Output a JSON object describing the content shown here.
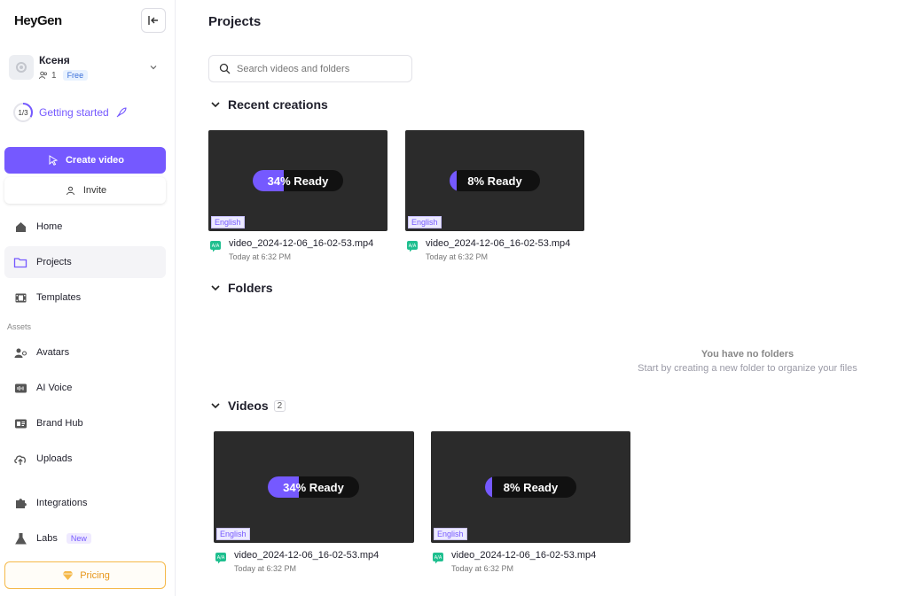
{
  "brand": {
    "logo_text": "HeyGen",
    "accent": "#7559ff",
    "pricing_color": "#e7961b"
  },
  "user": {
    "name": "Ксеня",
    "members": "1",
    "plan": "Free"
  },
  "getting_started": {
    "progress": "1/3",
    "progress_fraction": 0.333,
    "label": "Getting started"
  },
  "actions": {
    "create_video": "Create video",
    "invite": "Invite",
    "pricing": "Pricing"
  },
  "nav": {
    "home": "Home",
    "projects": "Projects",
    "templates": "Templates",
    "assets_section": "Assets",
    "avatars": "Avatars",
    "ai_voice": "AI Voice",
    "brand_hub": "Brand Hub",
    "uploads": "Uploads",
    "integrations": "Integrations",
    "labs": "Labs",
    "labs_badge": "New"
  },
  "main": {
    "title": "Projects",
    "search_placeholder": "Search videos and folders",
    "recent_heading": "Recent creations",
    "folders_heading": "Folders",
    "folders_empty_title": "You have no folders",
    "folders_empty_sub": "Start by creating a new folder to organize your files",
    "videos_heading": "Videos",
    "videos_count": "2"
  },
  "recent": [
    {
      "status": "34% Ready",
      "progress": 0.34,
      "language": "English",
      "name": "video_2024-12-06_16-02-53.mp4",
      "time": "Today at 6:32 PM"
    },
    {
      "status": "8% Ready",
      "progress": 0.08,
      "language": "English",
      "name": "video_2024-12-06_16-02-53.mp4",
      "time": "Today at 6:32 PM"
    }
  ],
  "videos": [
    {
      "status": "34% Ready",
      "progress": 0.34,
      "language": "English",
      "name": "video_2024-12-06_16-02-53.mp4",
      "time": "Today at 6:32 PM"
    },
    {
      "status": "8% Ready",
      "progress": 0.08,
      "language": "English",
      "name": "video_2024-12-06_16-02-53.mp4",
      "time": "Today at 6:32 PM"
    }
  ]
}
